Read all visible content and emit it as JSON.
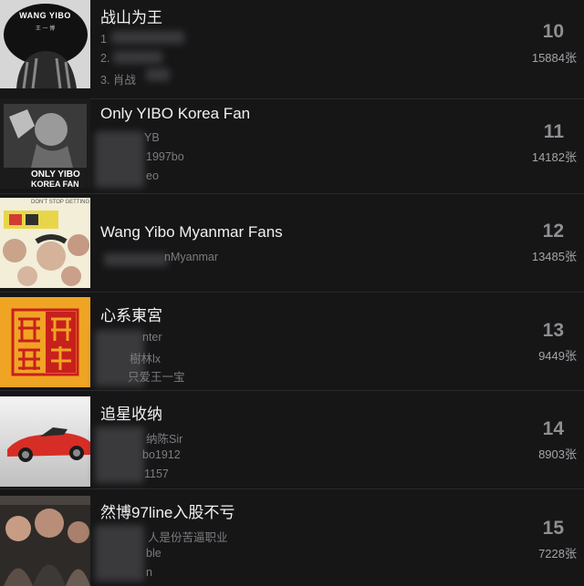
{
  "rows": [
    {
      "title": "战山为王",
      "lines": [
        "1",
        "2.",
        "3. 肖战"
      ],
      "rank": "10",
      "count": "15884张",
      "thumb": {
        "top": "WANG YIBO",
        "sub": "王 一 博",
        "tag": "",
        "tag2": ""
      }
    },
    {
      "title": "Only YIBO Korea Fan",
      "lines": [
        "YB",
        "1997bo",
        "eo"
      ],
      "rank": "11",
      "count": "14182张",
      "thumb": {
        "top": "",
        "sub": "",
        "tag": "ONLY YIBO",
        "tag2": "KOREA FAN"
      }
    },
    {
      "title": "Wang Yibo Myanmar Fans",
      "lines": [
        "nMyanmar"
      ],
      "rank": "12",
      "count": "13485张",
      "thumb": {
        "top": "DON'T STOP GETTING",
        "sub": "",
        "tag": "",
        "tag2": ""
      }
    },
    {
      "title": "心系東宮",
      "lines": [
        "nter",
        "樹林lx",
        "只爱王一宝"
      ],
      "rank": "13",
      "count": "9449张",
      "thumb": {
        "top": "",
        "sub": "",
        "tag": "",
        "tag2": ""
      }
    },
    {
      "title": "追星收纳",
      "lines": [
        "纳陈Sir",
        "bo1912",
        "1157"
      ],
      "rank": "14",
      "count": "8903张",
      "thumb": {
        "top": "",
        "sub": "",
        "tag": "",
        "tag2": ""
      }
    },
    {
      "title": "然博97line入股不亏",
      "lines": [
        "人是份苦逼职业",
        "ble",
        "n"
      ],
      "rank": "15",
      "count": "7228张",
      "thumb": {
        "top": "",
        "sub": "",
        "tag": "",
        "tag2": ""
      }
    }
  ]
}
